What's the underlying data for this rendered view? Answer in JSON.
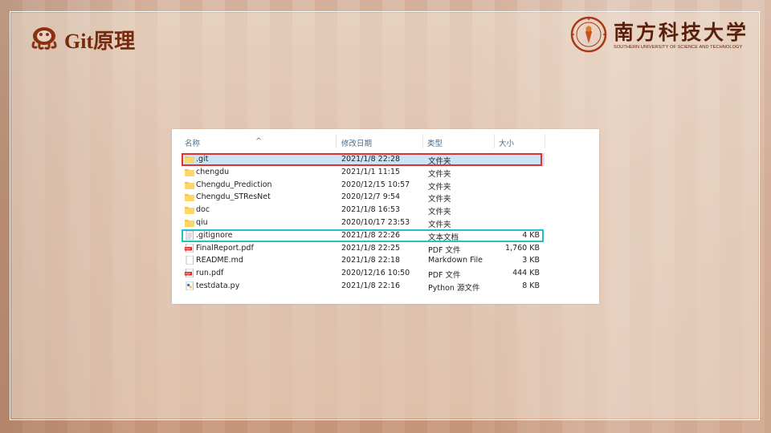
{
  "slide": {
    "title": "Git原理",
    "university": {
      "name_cn": "南方科技大学",
      "name_en": "SOUTHERN UNIVERSITY OF SCIENCE AND TECHNOLOGY",
      "brand_color": "#7a2a0c"
    }
  },
  "explorer": {
    "columns": {
      "name": "名称",
      "date": "修改日期",
      "type": "类型",
      "size": "大小"
    },
    "files": [
      {
        "name": ".git",
        "date": "2021/1/8 22:28",
        "type": "文件夹",
        "size": "",
        "icon": "folder-icon",
        "selected": true
      },
      {
        "name": "chengdu",
        "date": "2021/1/1 11:15",
        "type": "文件夹",
        "size": "",
        "icon": "folder-icon"
      },
      {
        "name": "Chengdu_Prediction",
        "date": "2020/12/15 10:57",
        "type": "文件夹",
        "size": "",
        "icon": "folder-icon"
      },
      {
        "name": "Chengdu_STResNet",
        "date": "2020/12/7 9:54",
        "type": "文件夹",
        "size": "",
        "icon": "folder-icon"
      },
      {
        "name": "doc",
        "date": "2021/1/8 16:53",
        "type": "文件夹",
        "size": "",
        "icon": "folder-icon"
      },
      {
        "name": "qiu",
        "date": "2020/10/17 23:53",
        "type": "文件夹",
        "size": "",
        "icon": "folder-icon"
      },
      {
        "name": ".gitignore",
        "date": "2021/1/8 22:26",
        "type": "文本文档",
        "size": "4 KB",
        "icon": "text-file-icon"
      },
      {
        "name": "FinalReport.pdf",
        "date": "2021/1/8 22:25",
        "type": "PDF 文件",
        "size": "1,760 KB",
        "icon": "pdf-icon"
      },
      {
        "name": "README.md",
        "date": "2021/1/8 22:18",
        "type": "Markdown File",
        "size": "3 KB",
        "icon": "file-icon"
      },
      {
        "name": "run.pdf",
        "date": "2020/12/16 10:50",
        "type": "PDF 文件",
        "size": "444 KB",
        "icon": "pdf-icon"
      },
      {
        "name": "testdata.py",
        "date": "2021/1/8 22:16",
        "type": "Python 源文件",
        "size": "8 KB",
        "icon": "python-file-icon"
      }
    ]
  },
  "highlights": {
    "red_color": "#e0312e",
    "cyan_color": "#1fc2c9"
  }
}
